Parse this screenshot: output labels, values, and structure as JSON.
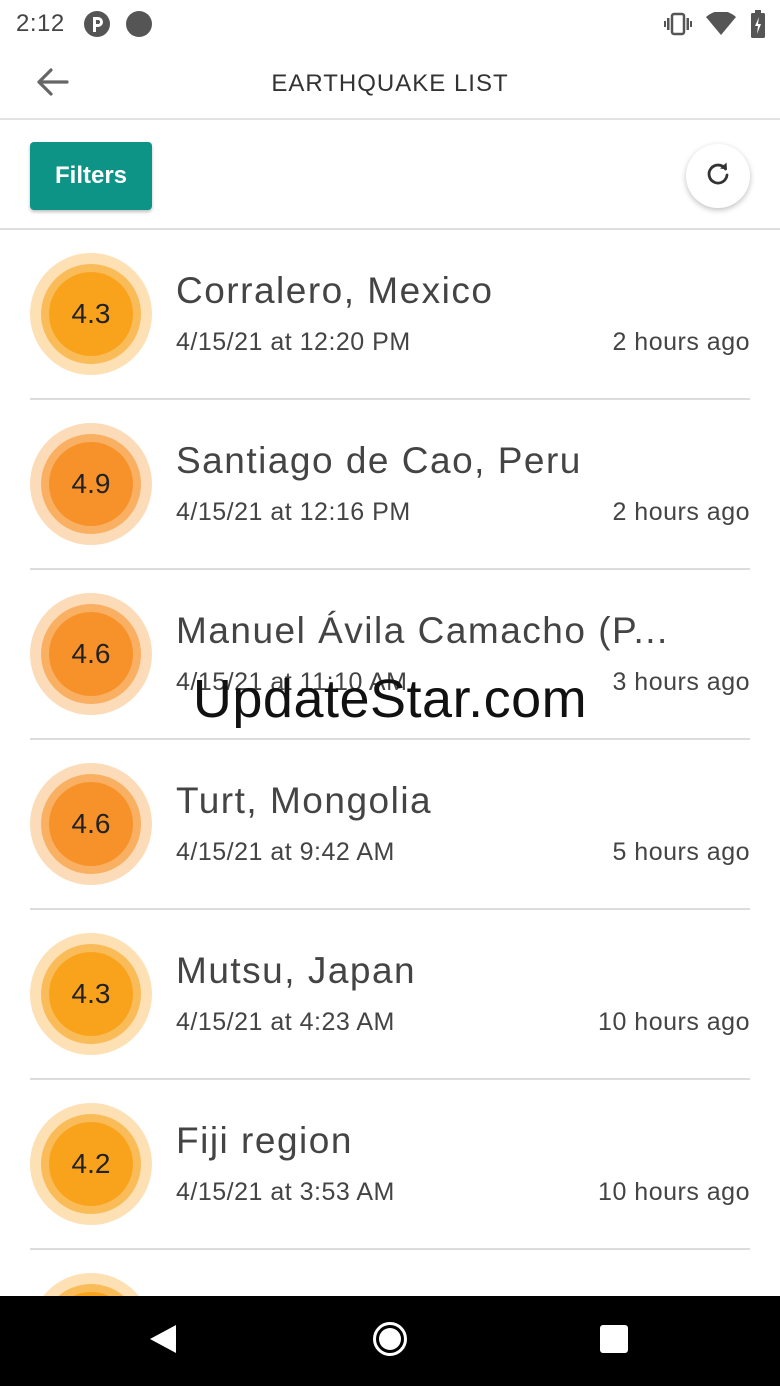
{
  "status_bar": {
    "time": "2:12",
    "left_icons": [
      "notification-icon",
      "dot-icon"
    ],
    "right_icons": [
      "vibrate-icon",
      "wifi-icon",
      "battery-icon"
    ]
  },
  "app_bar": {
    "back_icon": "arrow-back-icon",
    "title": "EARTHQUAKE LIST"
  },
  "toolbar": {
    "filters_label": "Filters",
    "refresh_icon": "refresh-icon",
    "accent": "#0e9486"
  },
  "quakes": [
    {
      "mag": "4.3",
      "location": "Corralero, Mexico",
      "date": "4/15/21 at 12:20 PM",
      "ago": "2 hours ago",
      "color": "#f9a31d"
    },
    {
      "mag": "4.9",
      "location": "Santiago de Cao, Peru",
      "date": "4/15/21 at 12:16 PM",
      "ago": "2 hours ago",
      "color": "#f7922a"
    },
    {
      "mag": "4.6",
      "location": "Manuel Ávila Camacho (P...",
      "date": "4/15/21 at 11:10 AM",
      "ago": "3 hours ago",
      "color": "#f7922a"
    },
    {
      "mag": "4.6",
      "location": "Turt, Mongolia",
      "date": "4/15/21 at 9:42 AM",
      "ago": "5 hours ago",
      "color": "#f7922a"
    },
    {
      "mag": "4.3",
      "location": "Mutsu, Japan",
      "date": "4/15/21 at 4:23 AM",
      "ago": "10 hours ago",
      "color": "#f9a31d"
    },
    {
      "mag": "4.2",
      "location": "Fiji region",
      "date": "4/15/21 at 3:53 AM",
      "ago": "10 hours ago",
      "color": "#f9a31d"
    },
    {
      "mag": "",
      "location": "",
      "date": "",
      "ago": "",
      "color": "#f9a31d"
    }
  ],
  "watermark": "UpdateStar.com",
  "nav_bar": {
    "icons": [
      "back-triangle-icon",
      "home-circle-icon",
      "recents-square-icon"
    ]
  }
}
